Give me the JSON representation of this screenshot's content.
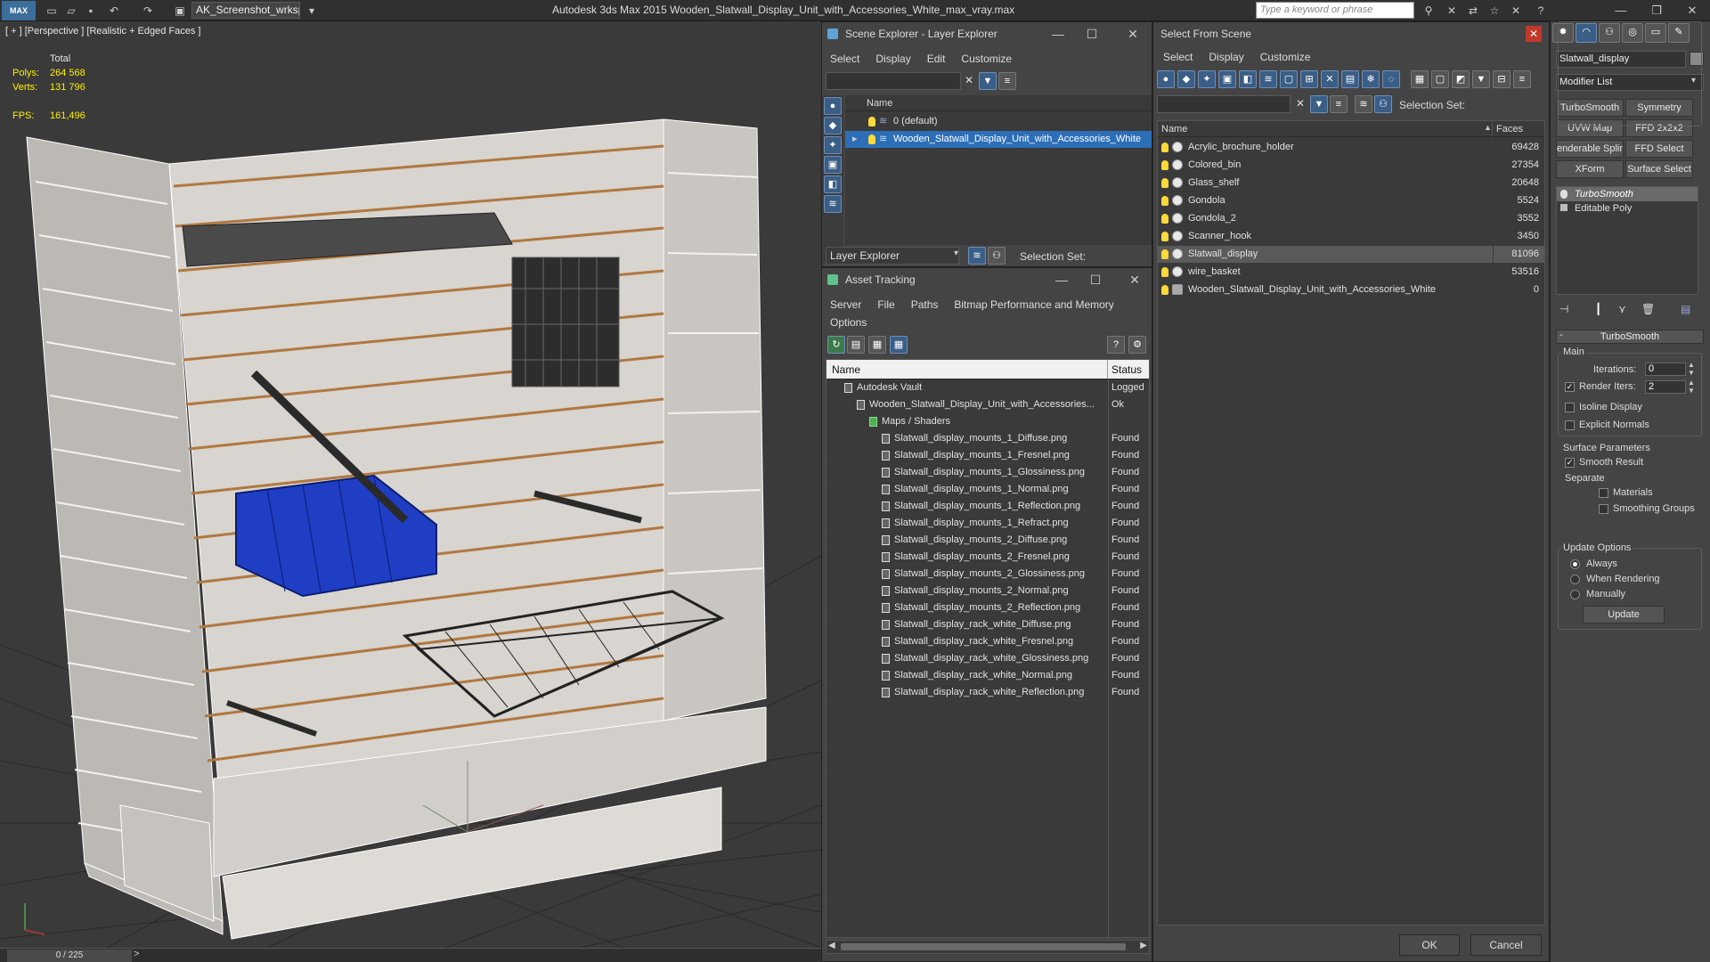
{
  "titlebar": {
    "logo": "MAX",
    "workspace": "AK_Screenshot_wrksp",
    "title": "Autodesk 3ds Max  2015    Wooden_Slatwall_Display_Unit_with_Accessories_White_max_vray.max",
    "search_placeholder": "Type a keyword or phrase"
  },
  "viewport": {
    "label": "[ + ] [Perspective ] [Realistic + Edged Faces ]",
    "stats": {
      "total_label": "Total",
      "polys_label": "Polys:",
      "polys_value": "264 568",
      "verts_label": "Verts:",
      "verts_value": "131 796",
      "fps_label": "FPS:",
      "fps_value": "161,496"
    },
    "timeline": "0 / 225"
  },
  "scene_explorer": {
    "title": "Scene Explorer - Layer Explorer",
    "menu": [
      "Select",
      "Display",
      "Edit",
      "Customize"
    ],
    "column": "Name",
    "layers": [
      "0 (default)",
      "Wooden_Slatwall_Display_Unit_with_Accessories_White"
    ],
    "footer_dropdown": "Layer Explorer",
    "selection_set": "Selection Set:"
  },
  "asset_tracking": {
    "title": "Asset Tracking",
    "menu1": [
      "Server",
      "File",
      "Paths",
      "Bitmap Performance and Memory"
    ],
    "menu2": [
      "Options"
    ],
    "col_name": "Name",
    "col_status": "Status",
    "rows": [
      {
        "name": "Autodesk Vault",
        "status": "Logged",
        "indent": 0
      },
      {
        "name": "Wooden_Slatwall_Display_Unit_with_Accessories...",
        "status": "Ok",
        "indent": 1
      },
      {
        "name": "Maps / Shaders",
        "status": "",
        "indent": 2
      },
      {
        "name": "Slatwall_display_mounts_1_Diffuse.png",
        "status": "Found",
        "indent": 3
      },
      {
        "name": "Slatwall_display_mounts_1_Fresnel.png",
        "status": "Found",
        "indent": 3
      },
      {
        "name": "Slatwall_display_mounts_1_Glossiness.png",
        "status": "Found",
        "indent": 3
      },
      {
        "name": "Slatwall_display_mounts_1_Normal.png",
        "status": "Found",
        "indent": 3
      },
      {
        "name": "Slatwall_display_mounts_1_Reflection.png",
        "status": "Found",
        "indent": 3
      },
      {
        "name": "Slatwall_display_mounts_1_Refract.png",
        "status": "Found",
        "indent": 3
      },
      {
        "name": "Slatwall_display_mounts_2_Diffuse.png",
        "status": "Found",
        "indent": 3
      },
      {
        "name": "Slatwall_display_mounts_2_Fresnel.png",
        "status": "Found",
        "indent": 3
      },
      {
        "name": "Slatwall_display_mounts_2_Glossiness.png",
        "status": "Found",
        "indent": 3
      },
      {
        "name": "Slatwall_display_mounts_2_Normal.png",
        "status": "Found",
        "indent": 3
      },
      {
        "name": "Slatwall_display_mounts_2_Reflection.png",
        "status": "Found",
        "indent": 3
      },
      {
        "name": "Slatwall_display_rack_white_Diffuse.png",
        "status": "Found",
        "indent": 3
      },
      {
        "name": "Slatwall_display_rack_white_Fresnel.png",
        "status": "Found",
        "indent": 3
      },
      {
        "name": "Slatwall_display_rack_white_Glossiness.png",
        "status": "Found",
        "indent": 3
      },
      {
        "name": "Slatwall_display_rack_white_Normal.png",
        "status": "Found",
        "indent": 3
      },
      {
        "name": "Slatwall_display_rack_white_Reflection.png",
        "status": "Found",
        "indent": 3
      }
    ]
  },
  "select_from_scene": {
    "title": "Select From Scene",
    "menu": [
      "Select",
      "Display",
      "Customize"
    ],
    "selection_set": "Selection Set:",
    "col_name": "Name",
    "col_faces": "Faces",
    "objects": [
      {
        "name": "Acrylic_brochure_holder",
        "faces": "69428"
      },
      {
        "name": "Colored_bin",
        "faces": "27354"
      },
      {
        "name": "Glass_shelf",
        "faces": "20648"
      },
      {
        "name": "Gondola",
        "faces": "5524"
      },
      {
        "name": "Gondola_2",
        "faces": "3552"
      },
      {
        "name": "Scanner_hook",
        "faces": "3450"
      },
      {
        "name": "Slatwall_display",
        "faces": "81096"
      },
      {
        "name": "wire_basket",
        "faces": "53516"
      },
      {
        "name": "Wooden_Slatwall_Display_Unit_with_Accessories_White",
        "faces": "0"
      }
    ],
    "ok": "OK",
    "cancel": "Cancel"
  },
  "command_panel": {
    "object_name": "Slatwall_display",
    "modifier_list": "Modifier List",
    "buttons": [
      "TurboSmooth",
      "Symmetry",
      "UVW Map",
      "FFD 2x2x2",
      "enderable Splin",
      "FFD Select",
      "XForm",
      "Surface Select"
    ],
    "stack": [
      "TurboSmooth",
      "Editable Poly"
    ],
    "rollout": "TurboSmooth",
    "main": "Main",
    "iterations_label": "Iterations:",
    "iterations": "0",
    "render_iters_label": "Render Iters:",
    "render_iters": "2",
    "isoline": "Isoline Display",
    "explicit_normals": "Explicit Normals",
    "surface_params": "Surface Parameters",
    "smooth_result": "Smooth Result",
    "separate": "Separate",
    "materials": "Materials",
    "smoothing_groups": "Smoothing Groups",
    "update_options": "Update Options",
    "always": "Always",
    "when_rendering": "When Rendering",
    "manually": "Manually",
    "update": "Update"
  }
}
